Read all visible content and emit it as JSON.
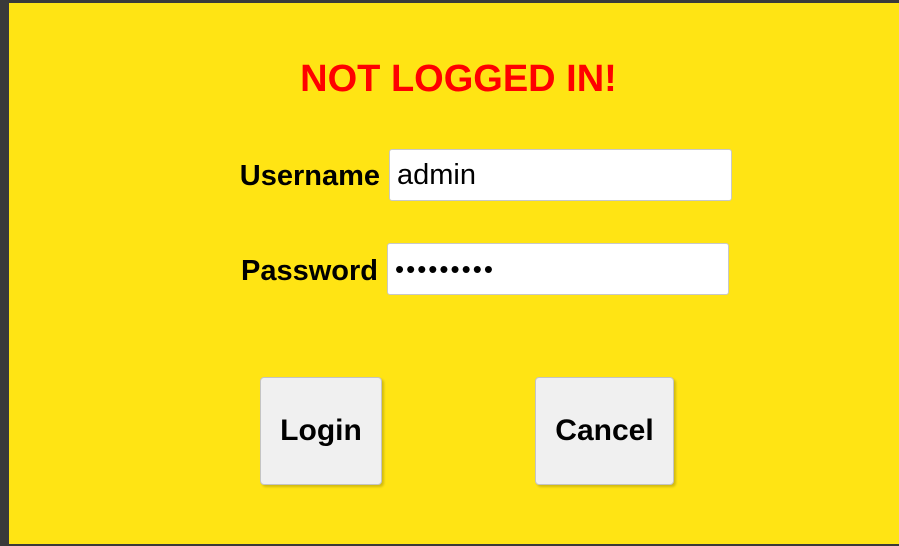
{
  "dialog": {
    "title": "NOT LOGGED IN!",
    "title_color": "#ff0000",
    "background_color": "#ffe414",
    "username": {
      "label": "Username",
      "value": "admin"
    },
    "password": {
      "label": "Password",
      "masked_value": "•••••••••"
    },
    "buttons": {
      "login_label": "Login",
      "cancel_label": "Cancel"
    }
  }
}
